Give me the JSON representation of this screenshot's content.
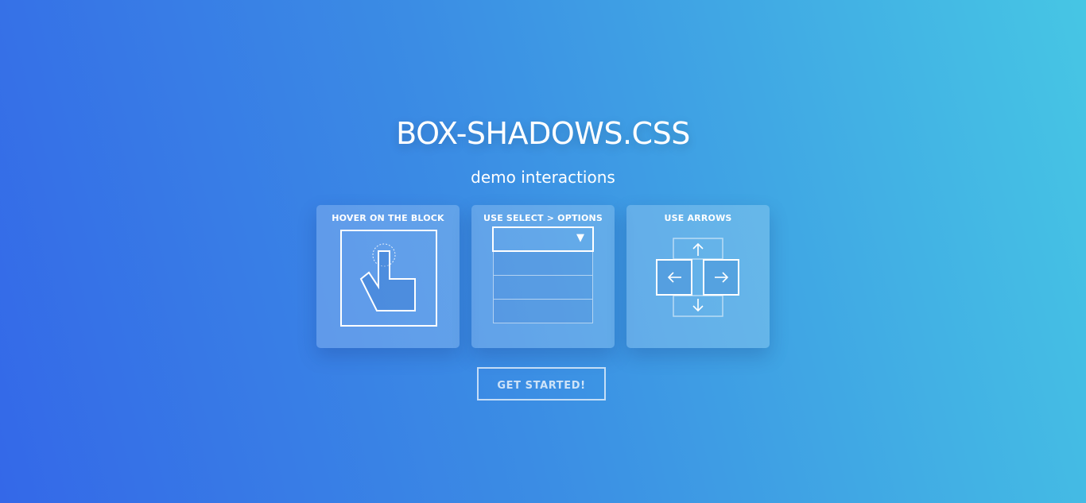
{
  "header": {
    "title": "BOX-SHADOWS.CSS",
    "subtitle": "demo interactions"
  },
  "cards": [
    {
      "label": "HOVER ON THE BLOCK",
      "icon": "hand-pointer-icon"
    },
    {
      "label": "USE SELECT > OPTIONS",
      "icon": "select-dropdown-icon",
      "arrow": "▼",
      "option_count": 3
    },
    {
      "label": "USE ARROWS",
      "icon": "arrow-keys-icon"
    }
  ],
  "cta": {
    "label": "GET STARTED!"
  },
  "colors": {
    "gradient_start": "#3468e8",
    "gradient_end": "#46c6e4",
    "text": "#ffffff"
  }
}
